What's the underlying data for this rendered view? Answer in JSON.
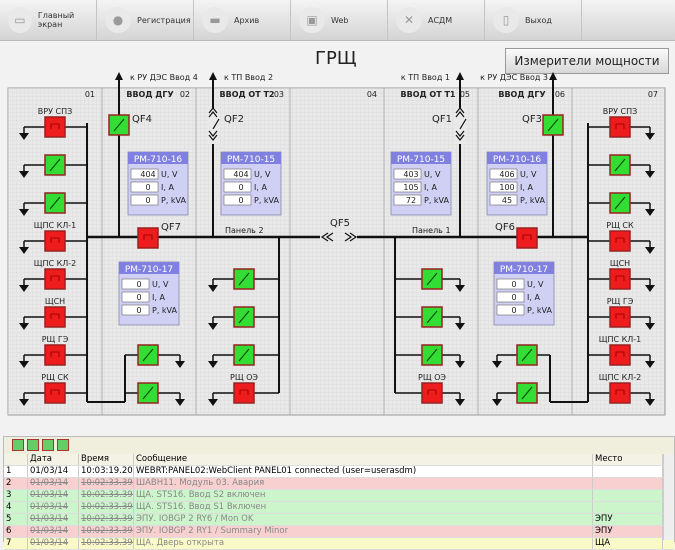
{
  "toolbar": [
    {
      "label": "Главный экран",
      "icon": "monitor-icon"
    },
    {
      "label": "Регистрация",
      "icon": "user-icon"
    },
    {
      "label": "Архив",
      "icon": "folder-icon"
    },
    {
      "label": "Web",
      "icon": "image-icon"
    },
    {
      "label": "АСДМ",
      "icon": "tools-icon"
    },
    {
      "label": "Выход",
      "icon": "trash-icon"
    }
  ],
  "title": "ГРЩ",
  "meters_button": "Измерители мощности",
  "colors": {
    "on": "#33dd33",
    "off": "#ee1c1c",
    "meter_header": "#8080e0",
    "meter_bg": "#d0d0f4"
  },
  "columns": [
    "01",
    "02",
    "03",
    "04",
    "05",
    "06",
    "07"
  ],
  "sections": [
    "ВВОД ДГУ",
    "ВВОД ОТ Т2",
    "ВВОД ОТ Т1",
    "ВВОД ДГУ"
  ],
  "inputs": [
    "к РУ ДЭС Ввод 4",
    "к ТП Ввод 2",
    "к ТП Ввод 1",
    "к РУ ДЭС Ввод 3"
  ],
  "breakers": {
    "QF4": {
      "label": "QF4",
      "state": "on"
    },
    "QF2": {
      "label": "QF2"
    },
    "QF1": {
      "label": "QF1"
    },
    "QF3": {
      "label": "QF3",
      "state": "on"
    },
    "QF7": {
      "label": "QF7",
      "state": "off"
    },
    "QF6": {
      "label": "QF6",
      "state": "off"
    },
    "QF5": {
      "label": "QF5"
    }
  },
  "panels": [
    "Панель 2",
    "Панель 1"
  ],
  "meters": [
    {
      "name": "PM-710-16",
      "u": "404",
      "i": "0",
      "p": "0"
    },
    {
      "name": "PM-710-15",
      "u": "404",
      "i": "0",
      "p": "0"
    },
    {
      "name": "PM-710-17",
      "u": "0",
      "i": "0",
      "p": "0"
    },
    {
      "name": "PM-710-15",
      "u": "403",
      "i": "105",
      "p": "72"
    },
    {
      "name": "PM-710-16",
      "u": "406",
      "i": "100",
      "p": "45"
    },
    {
      "name": "PM-710-17",
      "u": "0",
      "i": "0",
      "p": "0"
    }
  ],
  "units": {
    "u": "U, V",
    "i": "I, A",
    "p": "P, kVA"
  },
  "feeders_left": [
    {
      "label": "ВРУ СПЗ",
      "state": "off"
    },
    {
      "label": "",
      "state": "on"
    },
    {
      "label": "",
      "state": "on"
    },
    {
      "label": "ЩПС КЛ-1",
      "state": "off"
    },
    {
      "label": "ЩПС КЛ-2",
      "state": "off"
    },
    {
      "label": "ЩСН",
      "state": "off"
    },
    {
      "label": "РЩ ГЭ",
      "state": "off"
    },
    {
      "label": "РЩ СК",
      "state": "off"
    }
  ],
  "feeders_right": [
    {
      "label": "ВРУ СПЗ",
      "state": "off"
    },
    {
      "label": "",
      "state": "on"
    },
    {
      "label": "",
      "state": "on"
    },
    {
      "label": "РЩ СК",
      "state": "off"
    },
    {
      "label": "ЩСН",
      "state": "off"
    },
    {
      "label": "РЩ ГЭ",
      "state": "off"
    },
    {
      "label": "ЩПС КЛ-1",
      "state": "off"
    },
    {
      "label": "ЩПС КЛ-2",
      "state": "off"
    }
  ],
  "feeders_dgu_left": [
    {
      "label": "",
      "state": "on"
    },
    {
      "label": "",
      "state": "on"
    }
  ],
  "feeders_dgu_right": [
    {
      "label": "",
      "state": "on"
    },
    {
      "label": "",
      "state": "on"
    }
  ],
  "feeders_panel2": [
    {
      "label": "",
      "state": "on"
    },
    {
      "label": "",
      "state": "on"
    },
    {
      "label": "",
      "state": "on"
    },
    {
      "label": "РЩ ОЭ",
      "state": "off"
    }
  ],
  "feeders_panel1": [
    {
      "label": "",
      "state": "on"
    },
    {
      "label": "",
      "state": "on"
    },
    {
      "label": "",
      "state": "on"
    },
    {
      "label": "РЩ ОЭ",
      "state": "off"
    }
  ],
  "log": {
    "headers": [
      "",
      "Дата",
      "Время",
      "Сообщение",
      "Место"
    ],
    "rows": [
      {
        "n": "1",
        "date": "01/03/14",
        "time": "10:03:19.204",
        "msg": "WEBRT:PANEL02:WebClient PANEL01 connected (user=userasdm)",
        "place": "",
        "color": "#ffffff",
        "old": false
      },
      {
        "n": "2",
        "date": "01/03/14",
        "time": "10:02:33.391",
        "msg": "ШАВН11. Модуль 03. Авария",
        "place": "",
        "color": "#f8d0d0",
        "old": true
      },
      {
        "n": "3",
        "date": "01/03/14",
        "time": "10:02:33.391",
        "msg": "ЩА. STS16. Ввод S2 включен",
        "place": "",
        "color": "#ccf5cc",
        "old": true
      },
      {
        "n": "4",
        "date": "01/03/14",
        "time": "10:02:33.391",
        "msg": "ЩА. STS16. Ввод S1 Включен",
        "place": "",
        "color": "#ccf5cc",
        "old": true
      },
      {
        "n": "5",
        "date": "01/03/14",
        "time": "10:02:33.391",
        "msg": "ЭПУ. IOBGP 2 RY6 / Mon OK",
        "place": "ЭПУ",
        "color": "#ccf5cc",
        "old": true
      },
      {
        "n": "6",
        "date": "01/03/14",
        "time": "10:02:33.391",
        "msg": "ЭПУ. IOBGP 2 RY1 / Summary Minor",
        "place": "ЭПУ",
        "color": "#f8d0d0",
        "old": true
      },
      {
        "n": "7",
        "date": "01/03/14",
        "time": "10:02:33.391",
        "msg": "ЩА. Дверь открыта",
        "place": "ЩА",
        "color": "#fafac8",
        "old": true
      }
    ]
  }
}
